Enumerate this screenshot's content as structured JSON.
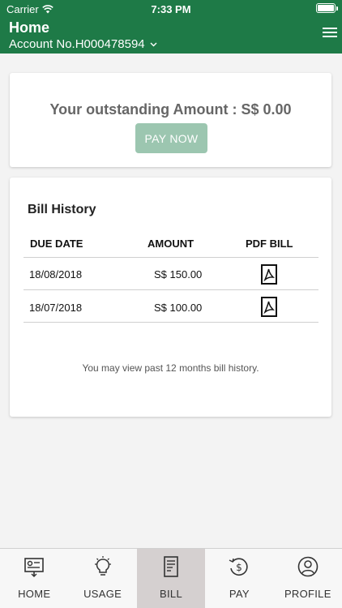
{
  "status_bar": {
    "carrier": "Carrier",
    "time": "7:33 PM"
  },
  "header": {
    "title": "Home",
    "account": "Account No.H000478594",
    "background": "#1e7a47"
  },
  "outstanding": {
    "text": "Your outstanding Amount : S$ 0.00",
    "pay_button": "PAY NOW"
  },
  "bill_history": {
    "title": "Bill History",
    "columns": [
      "DUE DATE",
      "AMOUNT",
      "PDF BILL"
    ],
    "rows": [
      {
        "due_date": "18/08/2018",
        "amount": "S$ 150.00",
        "pdf": "pdf-icon"
      },
      {
        "due_date": "18/07/2018",
        "amount": "S$ 100.00",
        "pdf": "pdf-icon"
      }
    ],
    "note": "You may view past 12 months bill history."
  },
  "tabs": [
    {
      "label": "HOME",
      "icon": "home-meter-icon"
    },
    {
      "label": "USAGE",
      "icon": "lightbulb-icon"
    },
    {
      "label": "BILL",
      "icon": "bill-icon",
      "active": true
    },
    {
      "label": "PAY",
      "icon": "pay-icon"
    },
    {
      "label": "PROFILE",
      "icon": "profile-icon"
    }
  ]
}
